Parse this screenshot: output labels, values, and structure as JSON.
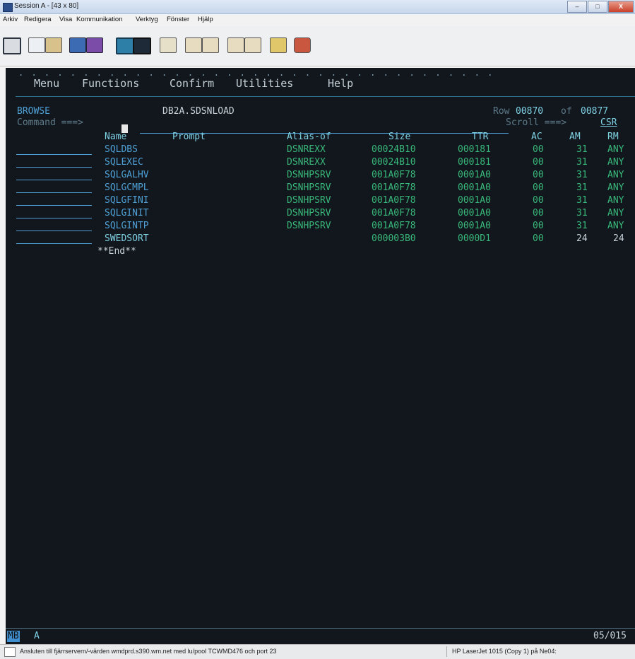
{
  "window": {
    "title": "Session A - [43 x 80]",
    "close_glyph": "X"
  },
  "menubar": [
    {
      "label": "Arkiv"
    },
    {
      "label": "Redigera"
    },
    {
      "label": "Visa"
    },
    {
      "label": "Kommunikation"
    },
    {
      "label": "Verktyg"
    },
    {
      "label": "Fönster"
    },
    {
      "label": "Hjälp"
    }
  ],
  "toolbar_icons": [
    "print-icon",
    "copy-icon",
    "paste-icon",
    "send-icon",
    "receive-icon",
    "display-icon",
    "setup-icon",
    "macro-icon",
    "record-icon",
    "stop-record-icon",
    "play-icon",
    "play-macro-icon",
    "clipboard-icon",
    "customize-icon"
  ],
  "ispf": {
    "menu": [
      {
        "label": "Menu",
        "key": "M"
      },
      {
        "label": "Functions",
        "key": "F"
      },
      {
        "label": "Confirm",
        "key": "C"
      },
      {
        "label": "Utilities",
        "key": "U"
      },
      {
        "label": "Help",
        "key": "H"
      }
    ],
    "mode": "BROWSE",
    "dataset": "DB2A.SDSNLOAD",
    "row_label": "Row",
    "row_current": "00870",
    "row_of": "of",
    "row_total": "00877",
    "command_label": "Command ===>",
    "scroll_label": "Scroll ===>",
    "scroll_value": "CSR",
    "headers": {
      "name": "Name",
      "prompt": "Prompt",
      "alias": "Alias-of",
      "size": "Size",
      "ttr": "TTR",
      "ac": "AC",
      "am": "AM",
      "rm": "RM"
    },
    "rows": [
      {
        "name": "SQLDBS",
        "alias": "DSNREXX",
        "size": "00024B10",
        "ttr": "000181",
        "ac": "00",
        "am": "31",
        "rm": "ANY"
      },
      {
        "name": "SQLEXEC",
        "alias": "DSNREXX",
        "size": "00024B10",
        "ttr": "000181",
        "ac": "00",
        "am": "31",
        "rm": "ANY"
      },
      {
        "name": "SQLGALHV",
        "alias": "DSNHPSRV",
        "size": "001A0F78",
        "ttr": "0001A0",
        "ac": "00",
        "am": "31",
        "rm": "ANY"
      },
      {
        "name": "SQLGCMPL",
        "alias": "DSNHPSRV",
        "size": "001A0F78",
        "ttr": "0001A0",
        "ac": "00",
        "am": "31",
        "rm": "ANY"
      },
      {
        "name": "SQLGFINI",
        "alias": "DSNHPSRV",
        "size": "001A0F78",
        "ttr": "0001A0",
        "ac": "00",
        "am": "31",
        "rm": "ANY"
      },
      {
        "name": "SQLGINIT",
        "alias": "DSNHPSRV",
        "size": "001A0F78",
        "ttr": "0001A0",
        "ac": "00",
        "am": "31",
        "rm": "ANY"
      },
      {
        "name": "SQLGINTP",
        "alias": "DSNHPSRV",
        "size": "001A0F78",
        "ttr": "0001A0",
        "ac": "00",
        "am": "31",
        "rm": "ANY"
      },
      {
        "name": "SWEDSORT",
        "alias": "",
        "size": "000003B0",
        "ttr": "0000D1",
        "ac": "00",
        "am": "24",
        "rm": "24"
      }
    ],
    "end_marker": "**End**"
  },
  "oia": {
    "indicator": "MB",
    "mode": "A",
    "cursor_pos": "05/015"
  },
  "status": {
    "message": "Ansluten till fjärrservern/-värden wmdprd.s390.wm.net med lu/pool TCWMD476 och port 23",
    "printer": "HP LaserJet 1015 (Copy 1) på Ne04:"
  },
  "colors": {
    "screen_bg": "#11171d",
    "text_green": "#39b87a",
    "text_blue": "#4fa0d6",
    "text_cyan": "#7fd1e4"
  }
}
